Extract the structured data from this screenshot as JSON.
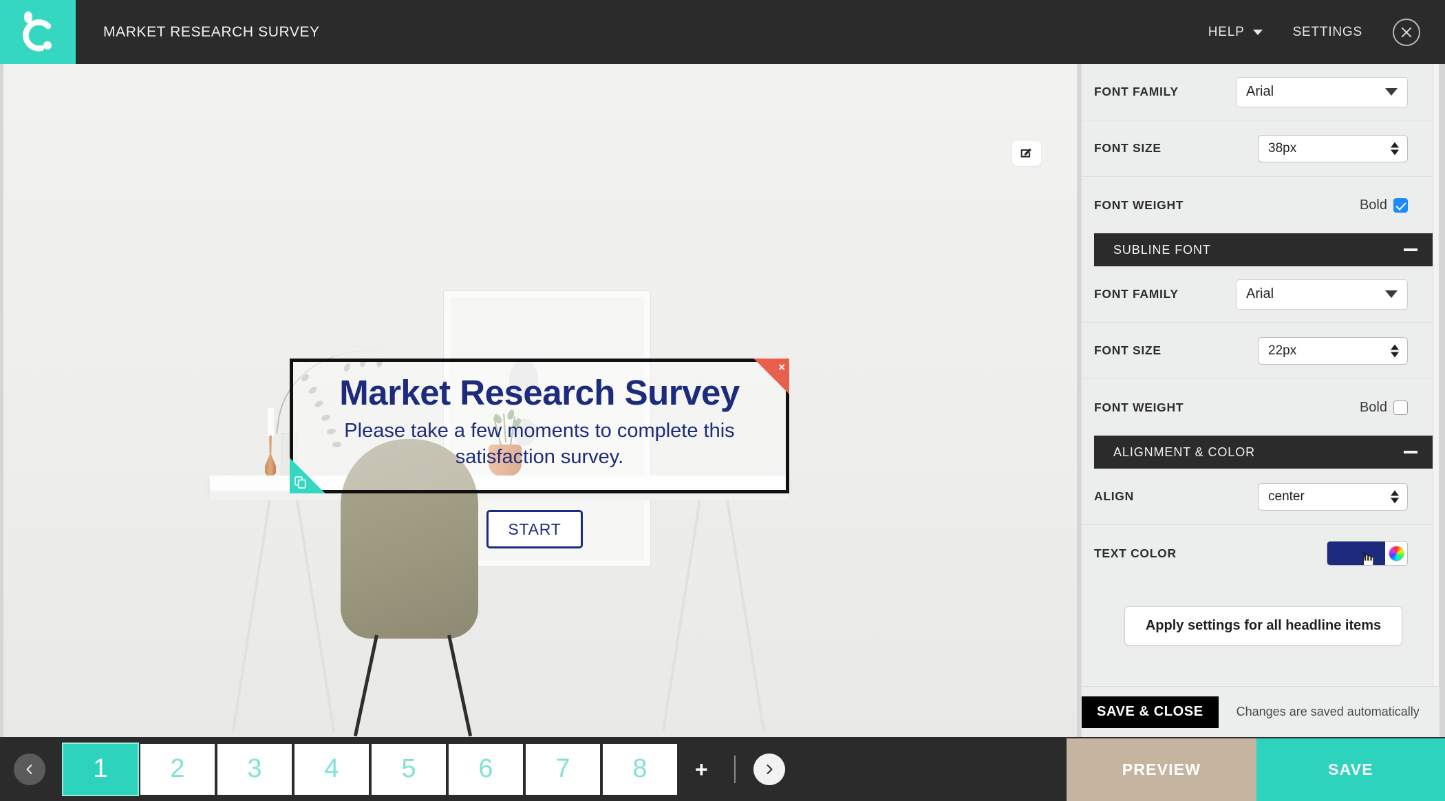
{
  "header": {
    "title": "MARKET RESEARCH SURVEY",
    "help_label": "HELP",
    "settings_label": "SETTINGS"
  },
  "canvas": {
    "headline": "Market Research Survey",
    "subline": "Please take a few moments to complete this satisfaction survey.",
    "start_button": "START",
    "delete_marker": "×"
  },
  "sidebar": {
    "headline_font": {
      "font_family_label": "FONT FAMILY",
      "font_family_value": "Arial",
      "font_size_label": "FONT SIZE",
      "font_size_value": "38px",
      "font_weight_label": "FONT WEIGHT",
      "bold_label": "Bold",
      "bold_checked": true
    },
    "subline_font": {
      "section_title": "SUBLINE FONT",
      "font_family_label": "FONT FAMILY",
      "font_family_value": "Arial",
      "font_size_label": "FONT SIZE",
      "font_size_value": "22px",
      "font_weight_label": "FONT WEIGHT",
      "bold_label": "Bold",
      "bold_checked": false
    },
    "alignment_color": {
      "section_title": "ALIGNMENT & COLOR",
      "align_label": "ALIGN",
      "align_value": "center",
      "text_color_label": "TEXT COLOR",
      "text_color_value": "#1d2b7d"
    },
    "apply_button": "Apply settings for all headline items",
    "save_close_button": "SAVE & CLOSE",
    "autosave_note": "Changes are saved automatically"
  },
  "footer": {
    "pages": [
      "1",
      "2",
      "3",
      "4",
      "5",
      "6",
      "7",
      "8"
    ],
    "active_page": "1",
    "add_page_label": "+",
    "preview_button": "PREVIEW",
    "save_button": "SAVE"
  },
  "colors": {
    "accent_teal": "#2ed3bd",
    "dark_chrome": "#2b2b2b",
    "headline_blue": "#1d2b7d",
    "preview_tan": "#c5b5a0",
    "delete_red": "#e8604b"
  }
}
